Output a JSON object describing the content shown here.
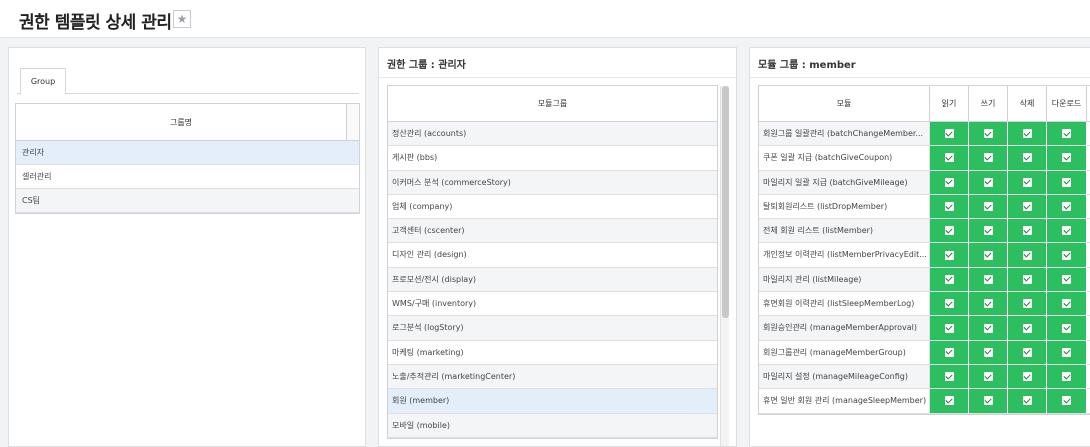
{
  "page": {
    "title": "권한 템플릿 상세 관리",
    "star_icon": "★"
  },
  "groups_panel": {
    "tab_label": "Group",
    "column_header": "그룹명",
    "rows": [
      "관리자",
      "셀러관리",
      "CS팀"
    ]
  },
  "modules_panel": {
    "title": "권한 그룹 : 관리자",
    "column_header": "모듈그룹",
    "rows": [
      "정산관리 (accounts)",
      "게시판 (bbs)",
      "이커머스 분석 (commerceStory)",
      "업체 (company)",
      "고객센터 (cscenter)",
      "디자인 관리 (design)",
      "프로모션/전시 (display)",
      "WMS/구매 (inventory)",
      "로그분석 (logStory)",
      "마케팅 (marketing)",
      "노출/추적관리 (marketingCenter)",
      "회원 (member)",
      "모바일 (mobile)"
    ],
    "selected_row": "회원 (member)"
  },
  "permissions_panel": {
    "title": "모듈 그룹 : member",
    "headers": {
      "module": "모듈",
      "read": "읽기",
      "write": "쓰기",
      "delete": "삭제",
      "download": "다운로드"
    },
    "rows": [
      {
        "name": "회원그룹 일괄관리 (batchChangeMember...",
        "read": true,
        "write": true,
        "delete": true,
        "download": true
      },
      {
        "name": "쿠폰 일괄 지급 (batchGiveCoupon)",
        "read": true,
        "write": true,
        "delete": true,
        "download": true
      },
      {
        "name": "마일리지 일괄 지급 (batchGiveMileage)",
        "read": true,
        "write": true,
        "delete": true,
        "download": true
      },
      {
        "name": "탈퇴회원리스트 (listDropMember)",
        "read": true,
        "write": true,
        "delete": true,
        "download": true
      },
      {
        "name": "전체 회원 리스트 (listMember)",
        "read": true,
        "write": true,
        "delete": true,
        "download": true
      },
      {
        "name": "개인정보 이력관리 (listMemberPrivacyEdit...",
        "read": true,
        "write": true,
        "delete": true,
        "download": true
      },
      {
        "name": "마일리지 관리 (listMileage)",
        "read": true,
        "write": true,
        "delete": true,
        "download": true
      },
      {
        "name": "휴면회원 이력관리 (listSleepMemberLog)",
        "read": true,
        "write": true,
        "delete": true,
        "download": true
      },
      {
        "name": "회원승인관리 (manageMemberApproval)",
        "read": true,
        "write": true,
        "delete": true,
        "download": true
      },
      {
        "name": "회원그룹관리 (manageMemberGroup)",
        "read": true,
        "write": true,
        "delete": true,
        "download": true
      },
      {
        "name": "마일리지 설정 (manageMileageConfig)",
        "read": true,
        "write": true,
        "delete": true,
        "download": true
      },
      {
        "name": "휴면 일반 회원 관리 (manageSleepMember)",
        "read": true,
        "write": true,
        "delete": true,
        "download": true
      }
    ]
  },
  "colors": {
    "check_green": "#2dbf5f",
    "selected_row": "#e4eefb"
  }
}
